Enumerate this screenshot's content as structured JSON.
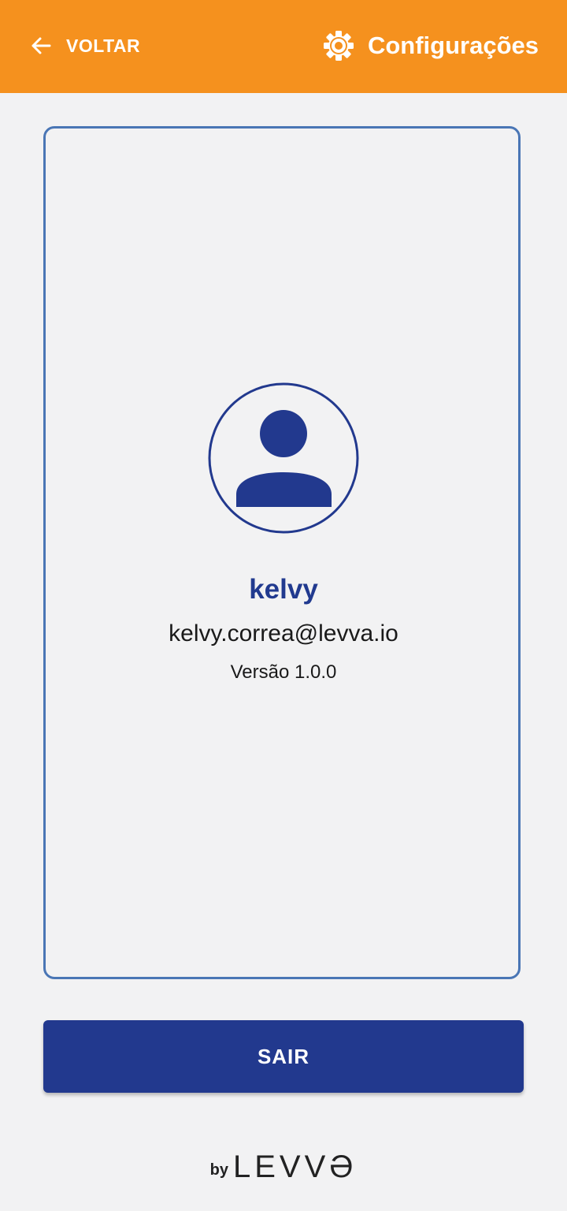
{
  "header": {
    "back_label": "VOLTAR",
    "back_icon": "arrow-left-icon",
    "title": "Configurações",
    "title_icon": "gear-icon",
    "background_color": "#f5911e"
  },
  "profile": {
    "avatar_icon": "user-avatar-icon",
    "name": "kelvy",
    "email": "kelvy.correa@levva.io",
    "version": "Versão 1.0.0"
  },
  "actions": {
    "logout_label": "SAIR",
    "button_color": "#22398e"
  },
  "footer": {
    "by_label": "by",
    "brand": "LEVVƏ"
  }
}
